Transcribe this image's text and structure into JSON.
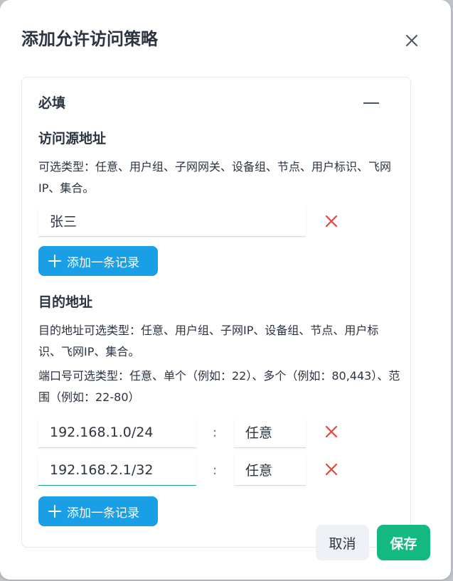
{
  "dialog": {
    "title": "添加允许访问策略",
    "close_icon": "close-icon"
  },
  "card": {
    "title": "必填",
    "collapse_icon": "minus-icon"
  },
  "source": {
    "title": "访问源地址",
    "hint": "可选类型：任意、用户组、子网网关、设备组、节点、用户标识、飞网IP、集合。",
    "rows": [
      {
        "value": "张三"
      }
    ],
    "add_label": "添加一条记录"
  },
  "destination": {
    "title": "目的地址",
    "hint": "目的地址可选类型：任意、用户组、子网IP、设备组、节点、用户标识、飞网IP、集合。",
    "port_hint": "端口号可选类型：任意、单个（例如：22）、多个（例如：80,443）、范围（例如：22-80）",
    "separator": ":",
    "rows": [
      {
        "address": "192.168.1.0/24",
        "port": "任意"
      },
      {
        "address": "192.168.2.1/32",
        "port": "任意"
      }
    ],
    "add_label": "添加一条记录"
  },
  "footer": {
    "cancel_label": "取消",
    "save_label": "保存"
  },
  "colors": {
    "primary_blue": "#1a9ee6",
    "save_green": "#14b881",
    "delete_red": "#e8453c",
    "focus_teal": "#1aa889"
  }
}
